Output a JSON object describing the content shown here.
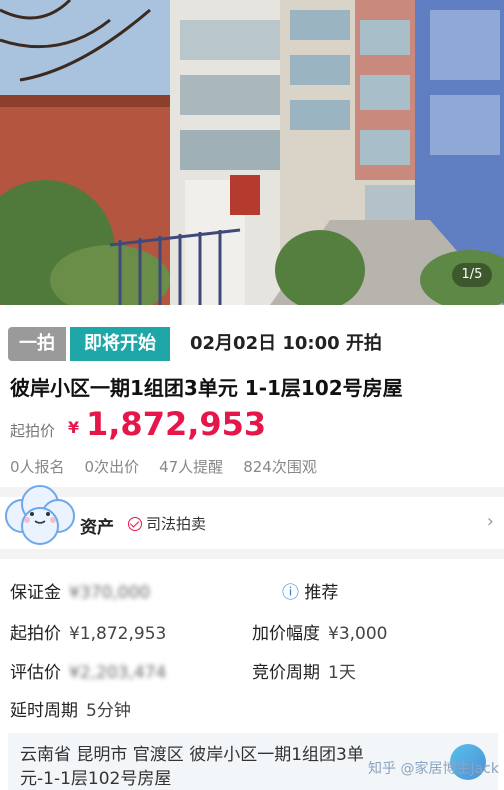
{
  "photo": {
    "counter": "1/5"
  },
  "status": {
    "tag_type": "一拍",
    "tag_state": "即将开始",
    "start_time": "02月02日 10:00  开拍",
    "colors": {
      "state": "#1fa6a6",
      "type": "#9a9a9a",
      "price": "#e5174a"
    }
  },
  "listing": {
    "title": "彼岸小区一期1组团3单元 1-1层102号房屋",
    "price_label": "起拍价",
    "currency": "¥",
    "price": "1,872,953",
    "stats": [
      "0人报名",
      "0次出价",
      "47人提醒",
      "824次围观"
    ]
  },
  "asset": {
    "title": "资产",
    "judicial": "司法拍卖",
    "chevron_icon": "chevron-right-icon"
  },
  "details": {
    "deposit_label": "保证金",
    "deposit_value": "¥370,000",
    "recommend_label": "推荐",
    "start_price_label": "起拍价",
    "start_price_value": "¥1,872,953",
    "increment_label": "加价幅度",
    "increment_value": "¥3,000",
    "appraisal_label": "评估价",
    "appraisal_value": "¥2,203,474",
    "period_label": "竞价周期",
    "period_value": "1天",
    "extend_label": "延时周期",
    "extend_value": "5分钟"
  },
  "address": {
    "line1": "云南省  昆明市  官渡区  彼岸小区一期1组团3单",
    "line2": "元-1-1层102号房屋",
    "watermark": "知乎 @家居博主Jack"
  }
}
